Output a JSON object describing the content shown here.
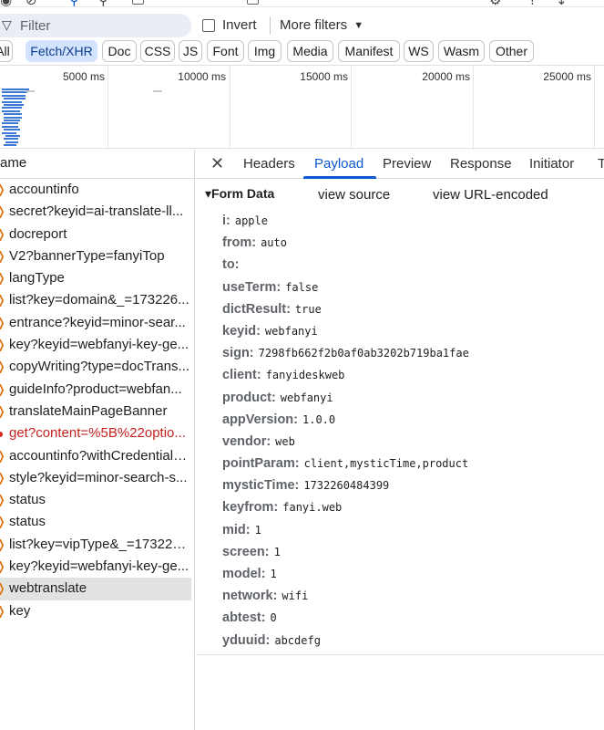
{
  "filter": {
    "placeholder": "Filter",
    "icon": "filter-icon"
  },
  "invert": {
    "label": "Invert",
    "checked": false
  },
  "more_filters": {
    "label": "More filters"
  },
  "chips": [
    {
      "label": "All",
      "active": false
    },
    {
      "label": "Fetch/XHR",
      "active": true
    },
    {
      "label": "Doc",
      "active": false
    },
    {
      "label": "CSS",
      "active": false
    },
    {
      "label": "JS",
      "active": false
    },
    {
      "label": "Font",
      "active": false
    },
    {
      "label": "Img",
      "active": false
    },
    {
      "label": "Media",
      "active": false
    },
    {
      "label": "Manifest",
      "active": false
    },
    {
      "label": "WS",
      "active": false
    },
    {
      "label": "Wasm",
      "active": false
    },
    {
      "label": "Other",
      "active": false
    }
  ],
  "timeline": {
    "ticks": [
      "5000 ms",
      "10000 ms",
      "15000 ms",
      "20000 ms",
      "25000 ms"
    ]
  },
  "requests": {
    "header": "ame",
    "items": [
      {
        "name": "accountinfo",
        "status": "ok"
      },
      {
        "name": "secret?keyid=ai-translate-ll...",
        "status": "ok"
      },
      {
        "name": "docreport",
        "status": "ok"
      },
      {
        "name": "V2?bannerType=fanyiTop",
        "status": "ok"
      },
      {
        "name": "langType",
        "status": "ok"
      },
      {
        "name": "list?key=domain&_=173226...",
        "status": "ok"
      },
      {
        "name": "entrance?keyid=minor-sear...",
        "status": "ok"
      },
      {
        "name": "key?keyid=webfanyi-key-ge...",
        "status": "ok"
      },
      {
        "name": "copyWriting?type=docTrans...",
        "status": "ok"
      },
      {
        "name": "guideInfo?product=webfan...",
        "status": "ok"
      },
      {
        "name": "translateMainPageBanner",
        "status": "ok"
      },
      {
        "name": "get?content=%5B%22optio...",
        "status": "error"
      },
      {
        "name": "accountinfo?withCredentials...",
        "status": "ok"
      },
      {
        "name": "style?keyid=minor-search-s...",
        "status": "ok"
      },
      {
        "name": "status",
        "status": "ok"
      },
      {
        "name": "status",
        "status": "ok"
      },
      {
        "name": "list?key=vipType&_=173226...",
        "status": "ok"
      },
      {
        "name": "key?keyid=webfanyi-key-ge...",
        "status": "ok"
      },
      {
        "name": "webtranslate",
        "status": "ok",
        "selected": true
      },
      {
        "name": "key",
        "status": "ok"
      }
    ]
  },
  "detail": {
    "close_icon": "close-icon",
    "tabs": [
      {
        "label": "Headers",
        "active": false
      },
      {
        "label": "Payload",
        "active": true
      },
      {
        "label": "Preview",
        "active": false
      },
      {
        "label": "Response",
        "active": false
      },
      {
        "label": "Initiator",
        "active": false
      },
      {
        "label": "T",
        "active": false
      }
    ],
    "section_title": "Form Data",
    "view_source": "view source",
    "view_url_encoded": "view URL-encoded",
    "params": [
      {
        "key": "i:",
        "value": "apple"
      },
      {
        "key": "from:",
        "value": "auto"
      },
      {
        "key": "to:",
        "value": ""
      },
      {
        "key": "useTerm:",
        "value": "false"
      },
      {
        "key": "dictResult:",
        "value": "true"
      },
      {
        "key": "keyid:",
        "value": "webfanyi"
      },
      {
        "key": "sign:",
        "value": "7298fb662f2b0af0ab3202b719ba1fae"
      },
      {
        "key": "client:",
        "value": "fanyideskweb"
      },
      {
        "key": "product:",
        "value": "webfanyi"
      },
      {
        "key": "appVersion:",
        "value": "1.0.0"
      },
      {
        "key": "vendor:",
        "value": "web"
      },
      {
        "key": "pointParam:",
        "value": "client,mysticTime,product"
      },
      {
        "key": "mysticTime:",
        "value": "1732260484399"
      },
      {
        "key": "keyfrom:",
        "value": "fanyi.web"
      },
      {
        "key": "mid:",
        "value": "1"
      },
      {
        "key": "screen:",
        "value": "1"
      },
      {
        "key": "model:",
        "value": "1"
      },
      {
        "key": "network:",
        "value": "wifi"
      },
      {
        "key": "abtest:",
        "value": "0"
      },
      {
        "key": "yduuid:",
        "value": "abcdefg"
      }
    ]
  },
  "colors": {
    "accent": "#0b57d0",
    "chip_active_bg": "#d3e3fd",
    "error": "#c5221f",
    "selected_row": "#e1e3e1"
  }
}
